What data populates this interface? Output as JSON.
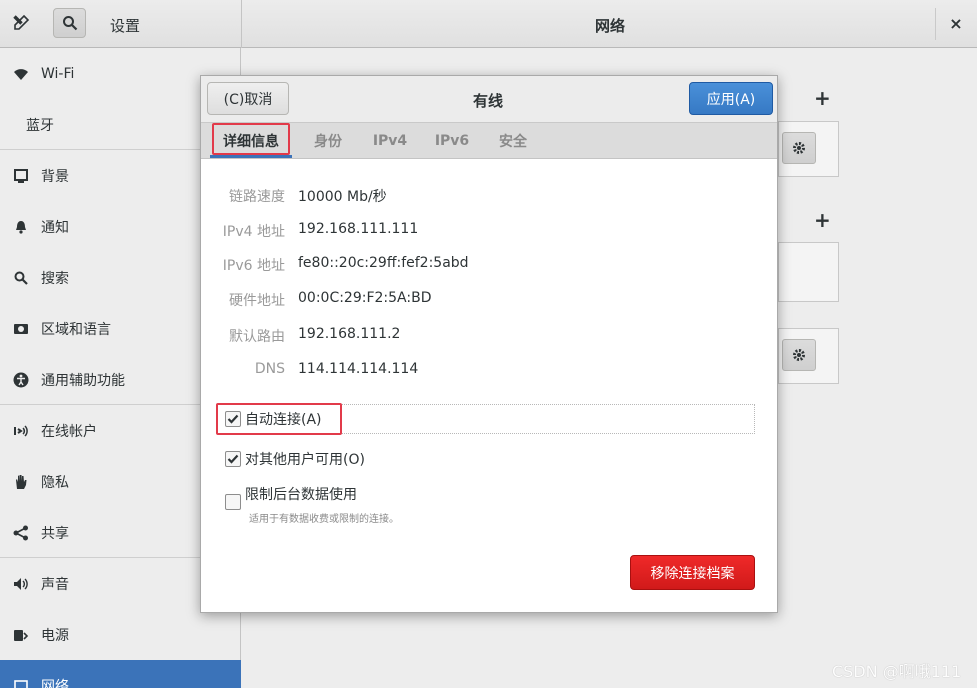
{
  "header": {
    "app_title": "设置",
    "page_title": "网络",
    "close_label": "×"
  },
  "sidebar": {
    "items": [
      {
        "label": "Wi-Fi",
        "icon": "wifi-icon"
      },
      {
        "label": "蓝牙",
        "icon": ""
      },
      {
        "label": "背景",
        "icon": "background-icon"
      },
      {
        "label": "通知",
        "icon": "bell-icon"
      },
      {
        "label": "搜索",
        "icon": "search-icon"
      },
      {
        "label": "区域和语言",
        "icon": "region-icon"
      },
      {
        "label": "通用辅助功能",
        "icon": "accessibility-icon"
      },
      {
        "label": "在线帐户",
        "icon": "online-accounts-icon"
      },
      {
        "label": "隐私",
        "icon": "hand-icon"
      },
      {
        "label": "共享",
        "icon": "share-icon"
      },
      {
        "label": "声音",
        "icon": "speaker-icon"
      },
      {
        "label": "电源",
        "icon": "power-icon"
      },
      {
        "label": "网络",
        "icon": "network-icon"
      }
    ],
    "active_index": 12
  },
  "background": {
    "add_label": "+"
  },
  "dialog": {
    "title": "有线",
    "cancel_label": "(C)取消",
    "apply_label": "应用(A)",
    "tabs": [
      "详细信息",
      "身份",
      "IPv4",
      "IPv6",
      "安全"
    ],
    "active_tab": 0,
    "details": [
      {
        "key": "链路速度",
        "value": "10000 Mb/秒"
      },
      {
        "key": "IPv4 地址",
        "value": "192.168.111.111"
      },
      {
        "key": "IPv6 地址",
        "value": "fe80::20c:29ff:fef2:5abd"
      },
      {
        "key": "硬件地址",
        "value": "00:0C:29:F2:5A:BD"
      },
      {
        "key": "默认路由",
        "value": "192.168.111.2"
      },
      {
        "key": "DNS",
        "value": "114.114.114.114"
      }
    ],
    "options": [
      {
        "label": "自动连接(A)",
        "checked": true
      },
      {
        "label": "对其他用户可用(O)",
        "checked": true
      },
      {
        "label": "限制后台数据使用",
        "checked": false
      }
    ],
    "limit_description": "适用于有数据收费或限制的连接。",
    "remove_label": "移除连接档案"
  },
  "colors": {
    "accent": "#3b73b9",
    "apply_button": "#3f84cf",
    "destructive": "#e02424",
    "highlight_box": "#e23a4a"
  },
  "watermark": "CSDN @啊哦111"
}
